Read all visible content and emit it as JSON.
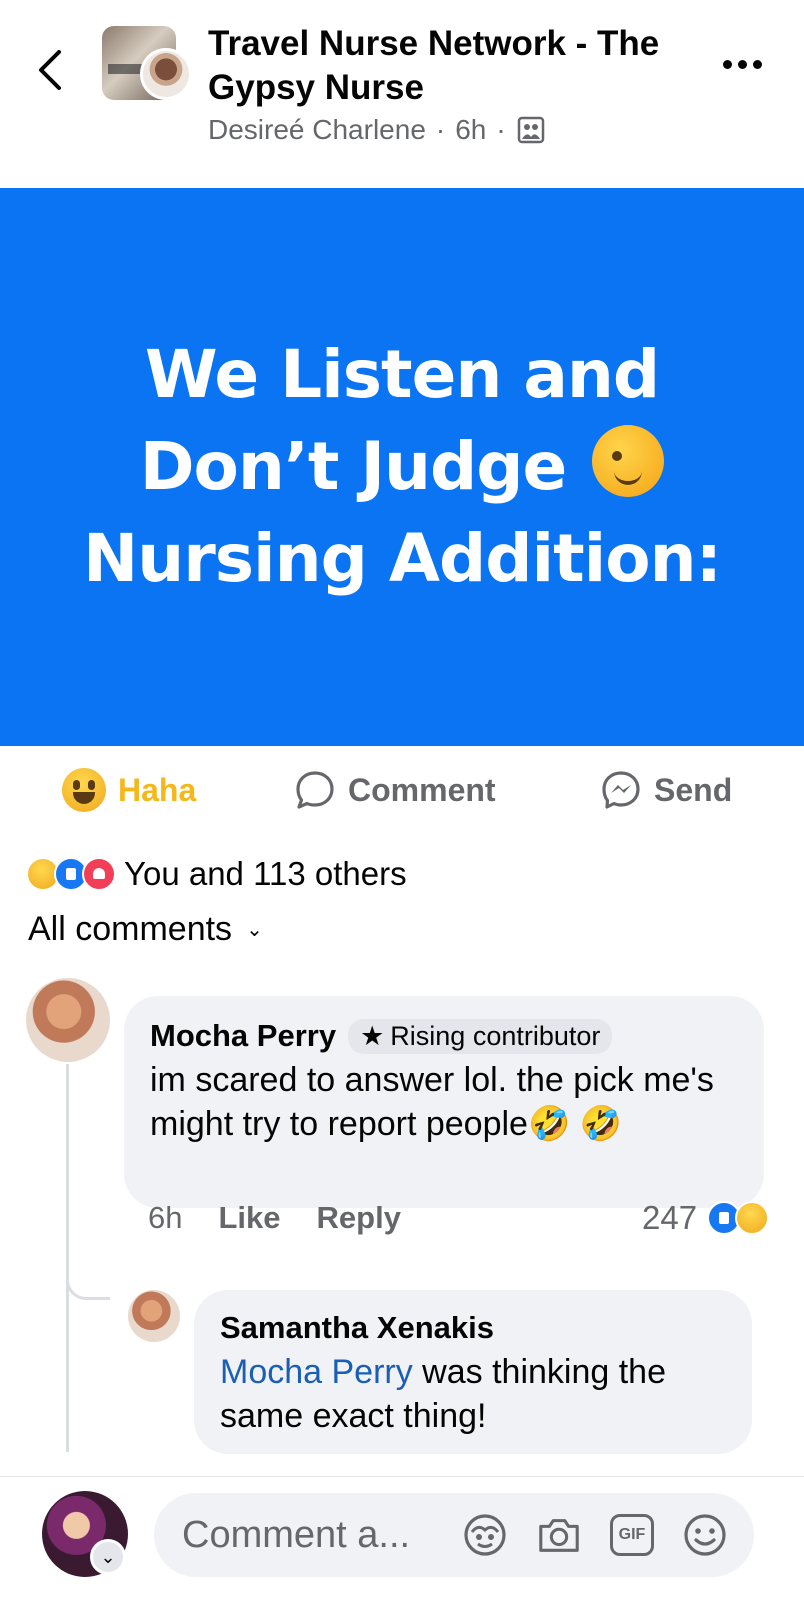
{
  "header": {
    "group_name": "Travel Nurse Network - The Gypsy Nurse",
    "author": "Desireé Charlene",
    "time": "6h",
    "separator": "·"
  },
  "post": {
    "line1": "We Listen and",
    "line2": "Don’t Judge",
    "line3": "Nursing Addition:",
    "background": "#0a74f2"
  },
  "actions": {
    "reaction_label": "Haha",
    "comment_label": "Comment",
    "send_label": "Send"
  },
  "reactions": {
    "summary": "You and 113 others",
    "icons": [
      "haha",
      "like",
      "love"
    ]
  },
  "comments_filter": {
    "label": "All comments"
  },
  "comments": [
    {
      "author": "Mocha Perry",
      "badge": "Rising contributor",
      "text": "im scared to answer lol. the pick me's might try to report people🤣 🤣",
      "time": "6h",
      "like_label": "Like",
      "reply_label": "Reply",
      "reaction_count": "247"
    }
  ],
  "replies": [
    {
      "author": "Samantha Xenakis",
      "mention": "Mocha Perry",
      "text": " was thinking the same exact thing!"
    }
  ],
  "composer": {
    "placeholder": "Comment a..."
  },
  "colors": {
    "accent": "#1877f2",
    "haha": "#f5b81a",
    "secondary_text": "#65676b",
    "bubble": "#f0f2f5"
  }
}
